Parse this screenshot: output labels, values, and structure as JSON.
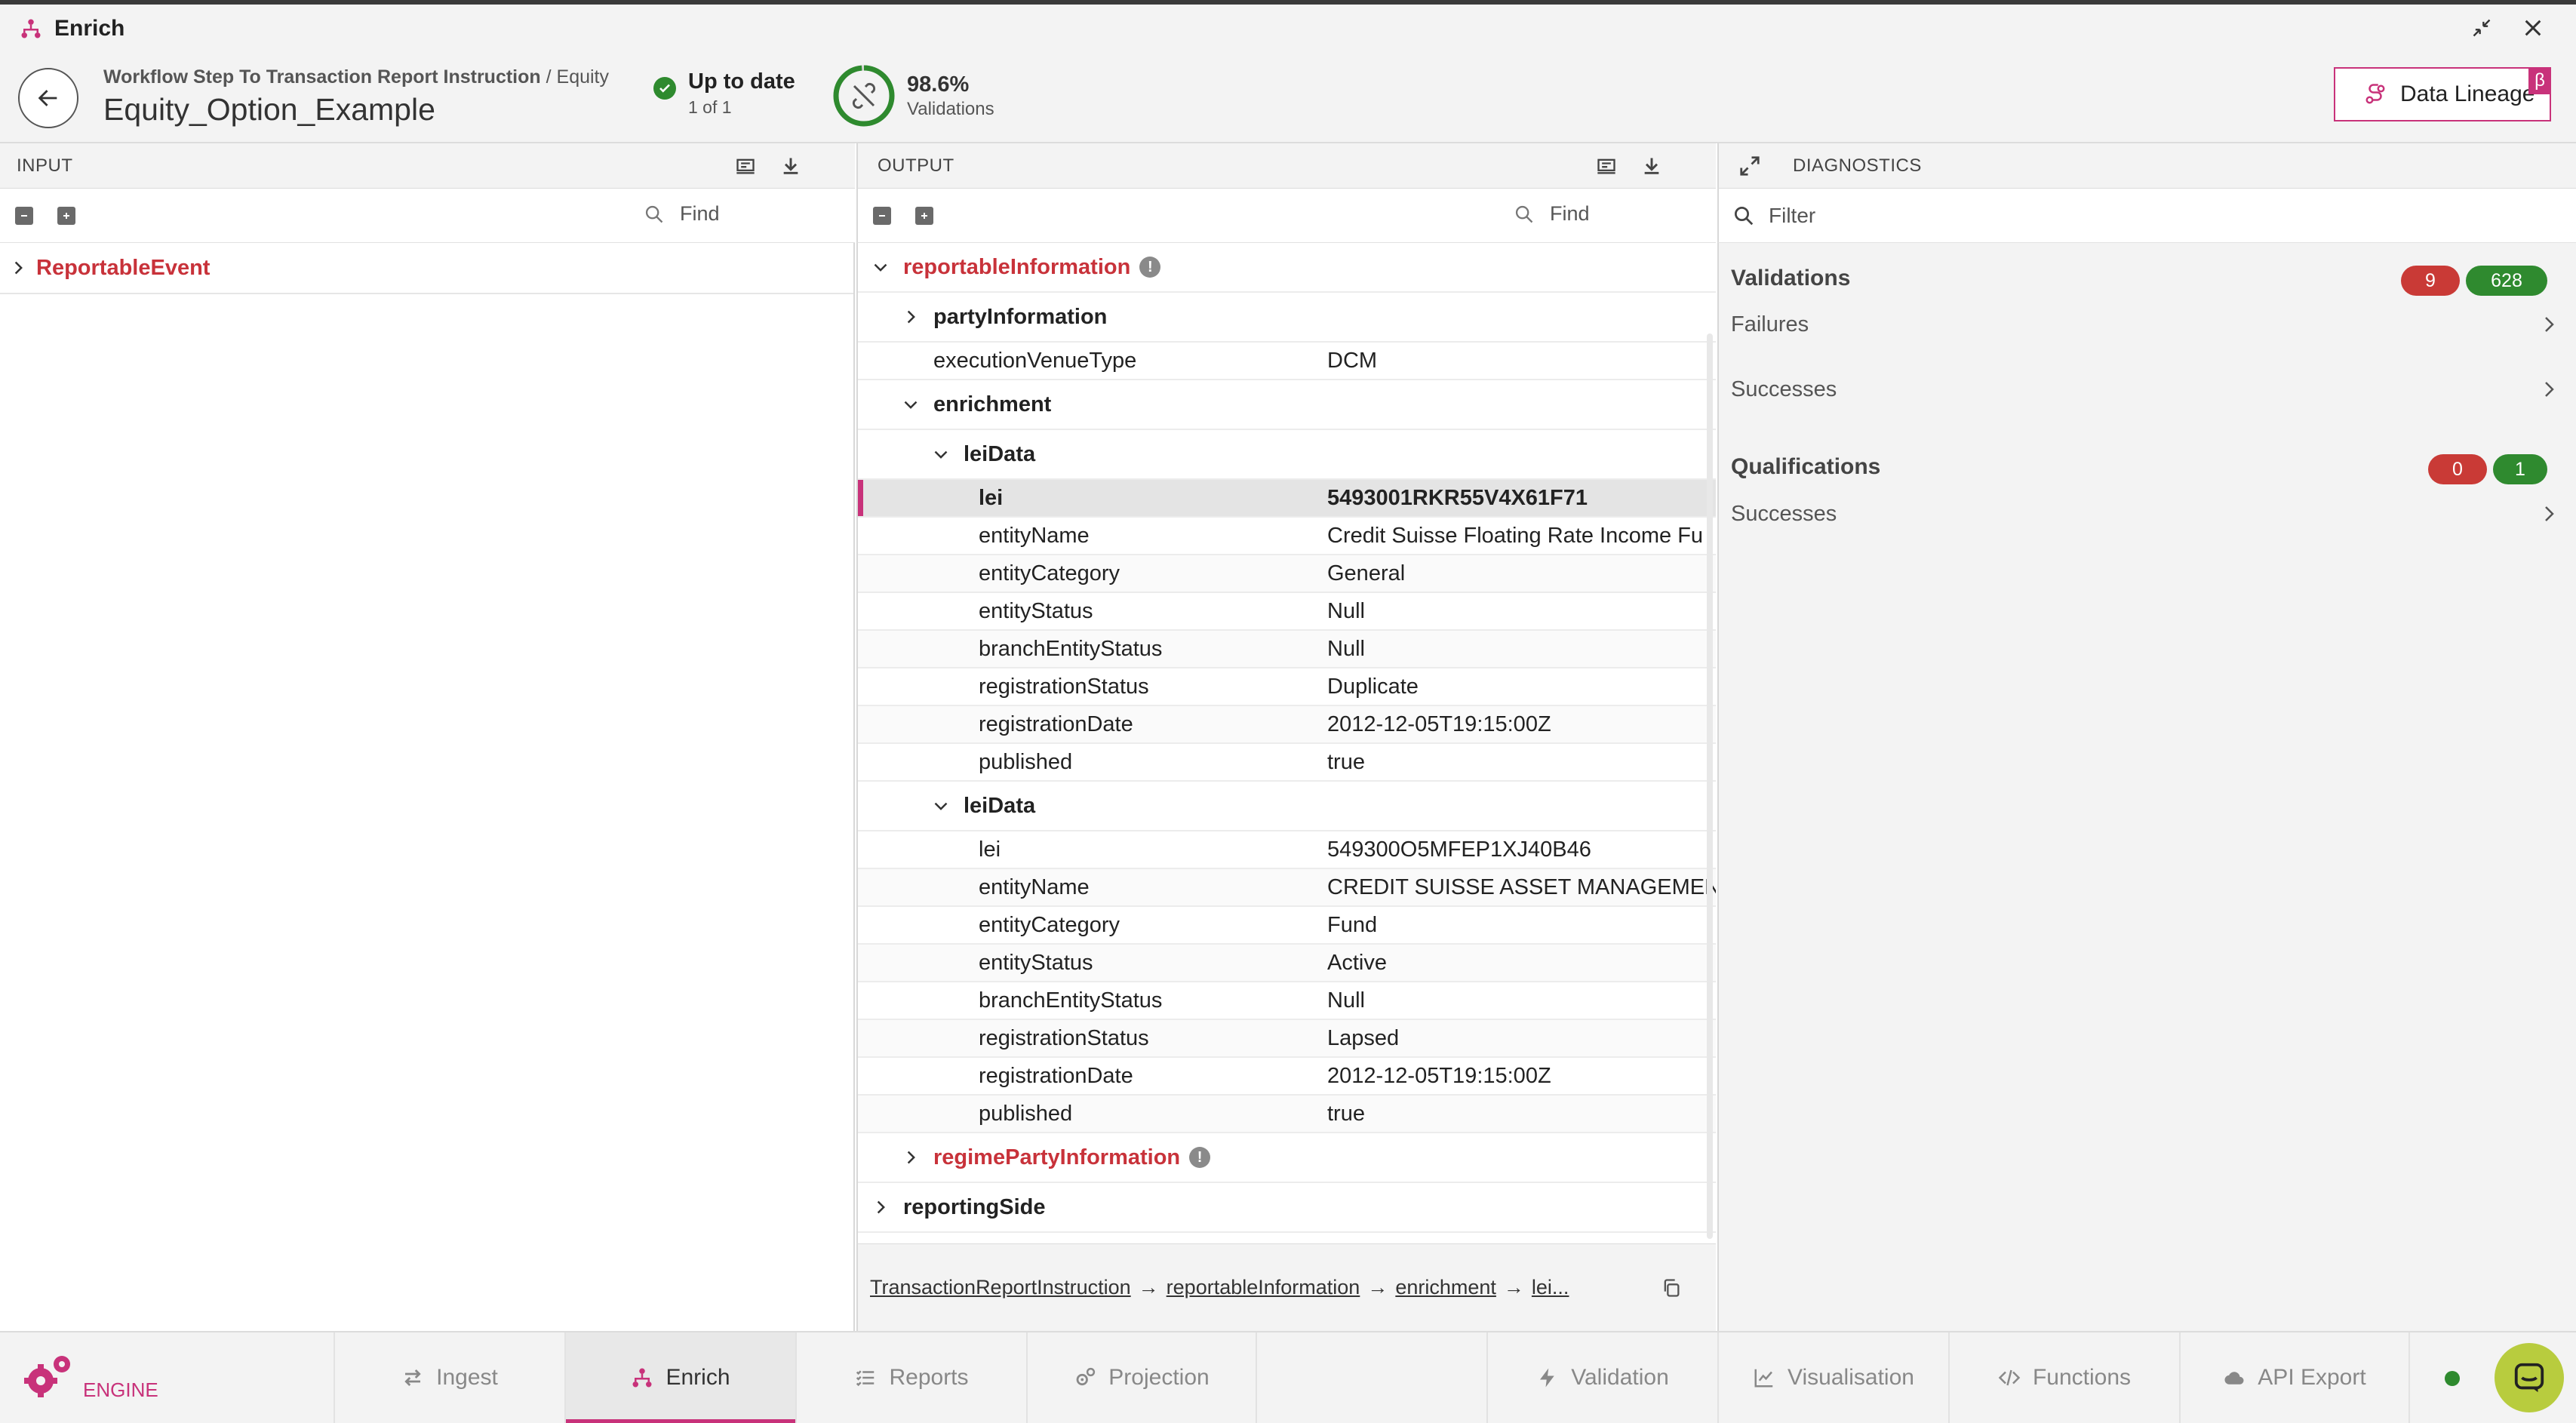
{
  "window": {
    "title": "Enrich",
    "icons": [
      "hierarchy-icon",
      "minimize-icon",
      "close-icon"
    ]
  },
  "header": {
    "breadcrumb_main": "Workflow Step To Transaction Report Instruction",
    "breadcrumb_sep": " / ",
    "breadcrumb_sub": "Equity",
    "title": "Equity_Option_Example",
    "status_title": "Up to date",
    "status_sub": "1 of 1",
    "validation_pct": "98.6%",
    "validation_fraction": 0.986,
    "validation_label": "Validations",
    "lineage_label": "Data Lineage",
    "lineage_badge": "β",
    "colors": {
      "accent": "#c8327a",
      "success": "#2e8a2e",
      "error": "#c93a36"
    }
  },
  "input": {
    "title": "INPUT",
    "find_placeholder": "Find",
    "root_label": "ReportableEvent"
  },
  "output": {
    "title": "OUTPUT",
    "find_placeholder": "Find",
    "rows": [
      {
        "name": "reportableInformation",
        "value": "",
        "kind": "node",
        "depth": 0,
        "expanded": true,
        "red": true,
        "warn": true
      },
      {
        "name": "partyInformation",
        "value": "",
        "kind": "node",
        "depth": 1,
        "expanded": false,
        "red": false,
        "warn": false
      },
      {
        "name": "executionVenueType",
        "value": "DCM",
        "kind": "leaf",
        "depth": 1
      },
      {
        "name": "enrichment",
        "value": "",
        "kind": "node",
        "depth": 1,
        "expanded": true,
        "red": false,
        "warn": false
      },
      {
        "name": "leiData",
        "value": "",
        "kind": "node",
        "depth": 2,
        "expanded": true,
        "red": false,
        "warn": false
      },
      {
        "name": "lei",
        "value": "5493001RKR55V4X61F71",
        "kind": "leaf",
        "depth": 3,
        "selected": true
      },
      {
        "name": "entityName",
        "value": "Credit Suisse Floating Rate Income Fu",
        "kind": "leaf",
        "depth": 3
      },
      {
        "name": "entityCategory",
        "value": "General",
        "kind": "leaf",
        "depth": 3
      },
      {
        "name": "entityStatus",
        "value": "Null",
        "kind": "leaf",
        "depth": 3
      },
      {
        "name": "branchEntityStatus",
        "value": "Null",
        "kind": "leaf",
        "depth": 3
      },
      {
        "name": "registrationStatus",
        "value": "Duplicate",
        "kind": "leaf",
        "depth": 3
      },
      {
        "name": "registrationDate",
        "value": "2012-12-05T19:15:00Z",
        "kind": "leaf",
        "depth": 3
      },
      {
        "name": "published",
        "value": "true",
        "kind": "leaf",
        "depth": 3
      },
      {
        "name": "leiData",
        "value": "",
        "kind": "node",
        "depth": 2,
        "expanded": true,
        "red": false,
        "warn": false
      },
      {
        "name": "lei",
        "value": "549300O5MFEP1XJ40B46",
        "kind": "leaf",
        "depth": 3
      },
      {
        "name": "entityName",
        "value": "CREDIT SUISSE ASSET MANAGEMEN",
        "kind": "leaf",
        "depth": 3
      },
      {
        "name": "entityCategory",
        "value": "Fund",
        "kind": "leaf",
        "depth": 3
      },
      {
        "name": "entityStatus",
        "value": "Active",
        "kind": "leaf",
        "depth": 3
      },
      {
        "name": "branchEntityStatus",
        "value": "Null",
        "kind": "leaf",
        "depth": 3
      },
      {
        "name": "registrationStatus",
        "value": "Lapsed",
        "kind": "leaf",
        "depth": 3
      },
      {
        "name": "registrationDate",
        "value": "2012-12-05T19:15:00Z",
        "kind": "leaf",
        "depth": 3
      },
      {
        "name": "published",
        "value": "true",
        "kind": "leaf",
        "depth": 3
      },
      {
        "name": "regimePartyInformation",
        "value": "",
        "kind": "node",
        "depth": 1,
        "expanded": false,
        "red": true,
        "warn": true
      },
      {
        "name": "reportingSide",
        "value": "",
        "kind": "node",
        "depth": 0,
        "expanded": false,
        "red": false,
        "warn": false
      }
    ],
    "path": {
      "segments": [
        "TransactionReportInstruction",
        "reportableInformation",
        "enrichment",
        "lei..."
      ],
      "arrow": "→"
    }
  },
  "diagnostics": {
    "title": "DIAGNOSTICS",
    "filter_placeholder": "Filter",
    "validations": {
      "title": "Validations",
      "failed": "9",
      "passed": "628",
      "rows": [
        "Failures",
        "Successes"
      ]
    },
    "qualifications": {
      "title": "Qualifications",
      "failed": "0",
      "passed": "1",
      "rows": [
        "Successes"
      ]
    }
  },
  "bottom_nav": {
    "brand": "ENGINE",
    "left_tabs": [
      {
        "label": "Ingest",
        "icon": "swap-arrows-icon",
        "active": false
      },
      {
        "label": "Enrich",
        "icon": "hierarchy-icon",
        "active": true
      },
      {
        "label": "Reports",
        "icon": "checklist-icon",
        "active": false
      },
      {
        "label": "Projection",
        "icon": "gears-icon",
        "active": false
      }
    ],
    "right_tabs": [
      {
        "label": "Validation",
        "icon": "bolt-icon"
      },
      {
        "label": "Visualisation",
        "icon": "line-chart-icon"
      },
      {
        "label": "Functions",
        "icon": "code-icon"
      },
      {
        "label": "API Export",
        "icon": "cloud-icon"
      }
    ]
  }
}
